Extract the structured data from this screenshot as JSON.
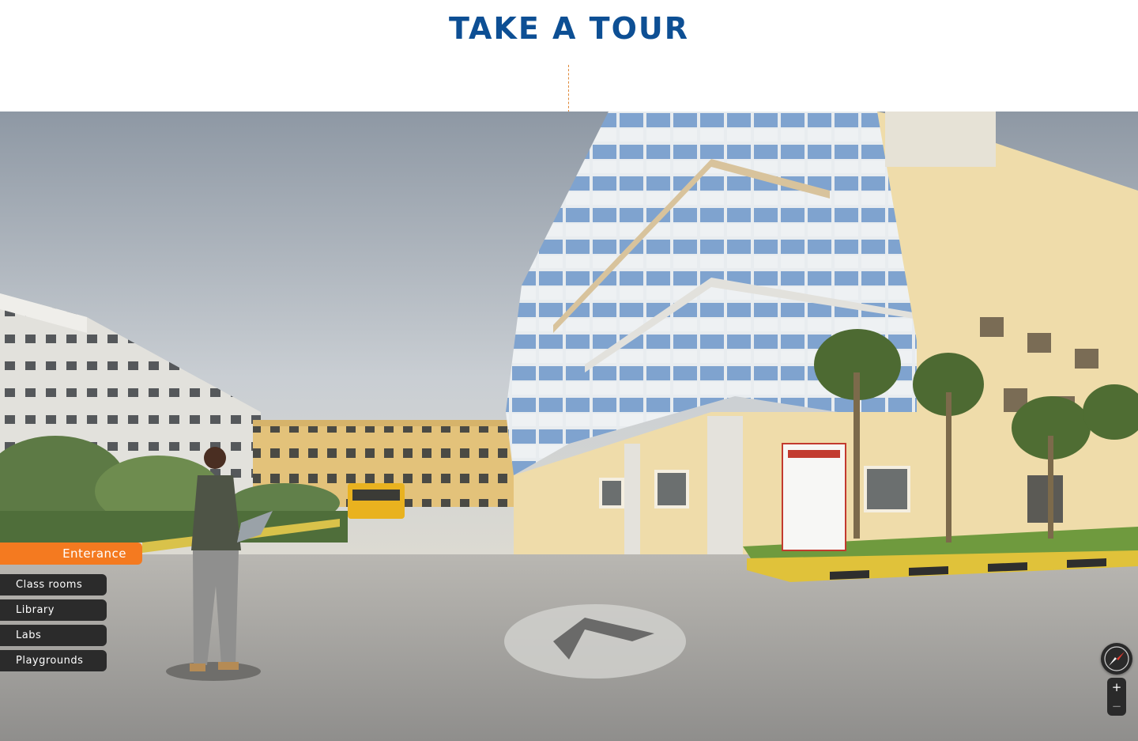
{
  "page": {
    "title": "TAKE A TOUR"
  },
  "tour_menu": {
    "active": "Enterance",
    "items": [
      {
        "label": "Class rooms"
      },
      {
        "label": "Library"
      },
      {
        "label": "Labs"
      },
      {
        "label": "Playgrounds"
      }
    ]
  },
  "controls": {
    "zoom_in": "+",
    "zoom_out": "−",
    "compass_icon": "compass-icon",
    "navigate_icon": "forward-arrow-icon"
  },
  "colors": {
    "title": "#0d4f94",
    "accent": "#f47a20",
    "menu_bg": "#2b2b2b"
  }
}
